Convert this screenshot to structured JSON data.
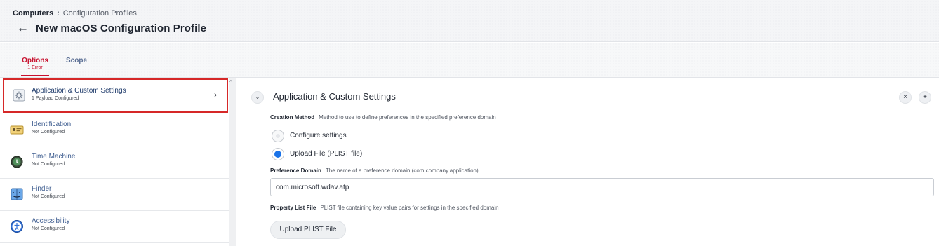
{
  "breadcrumb": {
    "parent": "Computers",
    "separator": ":",
    "current": "Configuration Profiles"
  },
  "page": {
    "back_icon": "←",
    "title": "New macOS Configuration Profile"
  },
  "tabs": [
    {
      "label": "Options",
      "sub": "1 Error",
      "active": true
    },
    {
      "label": "Scope",
      "sub": "",
      "active": false
    }
  ],
  "sidebar": {
    "items": [
      {
        "label": "Application & Custom Settings",
        "status": "1 Payload Configured",
        "icon": "gear-app-icon",
        "selected": true
      },
      {
        "label": "Identification",
        "status": "Not Configured",
        "icon": "id-card-icon"
      },
      {
        "label": "Time Machine",
        "status": "Not Configured",
        "icon": "time-machine-icon"
      },
      {
        "label": "Finder",
        "status": "Not Configured",
        "icon": "finder-icon"
      },
      {
        "label": "Accessibility",
        "status": "Not Configured",
        "icon": "accessibility-icon"
      }
    ]
  },
  "section": {
    "title": "Application & Custom Settings",
    "collapse_icon": "⌄",
    "remove_icon": "×",
    "add_icon": "+"
  },
  "creation_method": {
    "label": "Creation Method",
    "description": "Method to use to define preferences in the specified preference domain",
    "options": [
      {
        "label": "Configure settings",
        "selected": false
      },
      {
        "label": "Upload File (PLIST file)",
        "selected": true
      }
    ]
  },
  "preference_domain": {
    "label": "Preference Domain",
    "description": "The name of a preference domain (com.company.application)",
    "value": "com.microsoft.wdav.atp"
  },
  "property_list": {
    "label": "Property List File",
    "description": "PLIST file containing key value pairs for settings in the specified domain",
    "button": "Upload PLIST File"
  },
  "colors": {
    "accent_red": "#c8102e",
    "selected_border": "#d62828",
    "radio_blue": "#1a73e8",
    "link_blue": "#3d5c8f"
  }
}
